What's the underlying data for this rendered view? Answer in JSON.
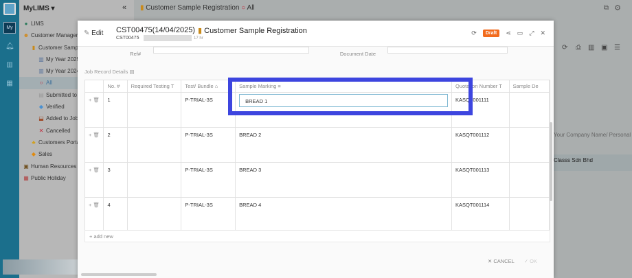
{
  "rail": {
    "my_label": "My"
  },
  "sidebar": {
    "brand": "MyLIMS",
    "items": [
      {
        "label": "LIMS",
        "icon": "globe-icon",
        "indent": 0
      },
      {
        "label": "Customer Management",
        "icon": "emoji-icon",
        "indent": 0
      },
      {
        "label": "Customer Sample Registration",
        "icon": "scroll-icon",
        "indent": 1
      },
      {
        "label": "My Year 2025",
        "icon": "chart-icon",
        "indent": 2
      },
      {
        "label": "My Year 2024",
        "icon": "chart-icon",
        "indent": 2
      },
      {
        "label": "All",
        "icon": "circle-icon",
        "indent": 2,
        "selected": true
      },
      {
        "label": "Submitted to Head",
        "icon": "doc-icon",
        "indent": 2
      },
      {
        "label": "Verified",
        "icon": "diamond-icon",
        "indent": 2
      },
      {
        "label": "Added to Job",
        "icon": "tray-icon",
        "indent": 2
      },
      {
        "label": "Cancelled",
        "icon": "x-icon",
        "indent": 2
      },
      {
        "label": "Customers Portal",
        "icon": "people-icon",
        "indent": 1
      },
      {
        "label": "Sales",
        "icon": "sales-icon",
        "indent": 1
      },
      {
        "label": "Human Resources",
        "icon": "hr-icon",
        "indent": 0
      },
      {
        "label": "Public Holiday",
        "icon": "calendar-icon",
        "indent": 0
      }
    ]
  },
  "topbar": {
    "module": "Customer Sample Registration",
    "view": "All"
  },
  "background": {
    "column_header": "Your Company Name/ Personal F",
    "row_value": "Classs Sdn Bhd"
  },
  "modal": {
    "mode": "Edit",
    "title": "CST00475(14/04/2025)",
    "module": "Customer Sample Registration",
    "doc_no": "CST00475",
    "age": "17 hr",
    "status": "Draft",
    "labels": {
      "ref": "Ref#",
      "doc_date": "Document Date",
      "job_record": "Job Record Details"
    },
    "columns": [
      "No.",
      "Required Testing",
      "Test/ Bundle",
      "Sample Marking",
      "Quotation Number",
      "Sample De"
    ],
    "rows": [
      {
        "no": "1",
        "required": "",
        "test": "P-TRIAL-3S",
        "marking": "BREAD 1",
        "quotation": "KASQT001111"
      },
      {
        "no": "2",
        "required": "",
        "test": "P-TRIAL-3S",
        "marking": "BREAD 2",
        "quotation": "KASQT001112"
      },
      {
        "no": "3",
        "required": "",
        "test": "P-TRIAL-3S",
        "marking": "BREAD 3",
        "quotation": "KASQT001113"
      },
      {
        "no": "4",
        "required": "",
        "test": "P-TRIAL-3S",
        "marking": "BREAD 4",
        "quotation": "KASQT001114"
      }
    ],
    "add_new": "+ add new",
    "cancel": "✕ CANCEL",
    "ok": "✓ OK"
  },
  "colors": {
    "rail": "#1b6f8c",
    "draft": "#f26b1d",
    "highlight": "#3d45df"
  }
}
